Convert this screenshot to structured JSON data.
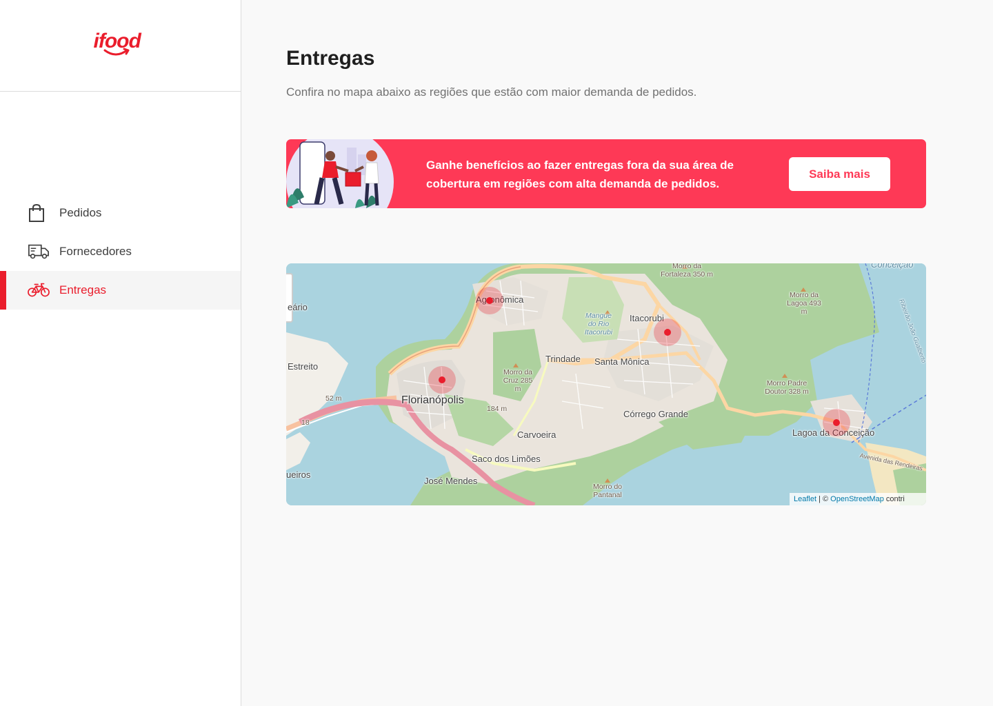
{
  "brand": {
    "logo_text": "ifood",
    "accent": "#ea1d2c",
    "banner_color": "#fe3956"
  },
  "sidebar": {
    "items": [
      {
        "label": "Pedidos",
        "icon": "shopping-bag-icon",
        "active": false
      },
      {
        "label": "Fornecedores",
        "icon": "truck-icon",
        "active": false
      },
      {
        "label": "Entregas",
        "icon": "bicycle-icon",
        "active": true
      }
    ]
  },
  "main": {
    "title": "Entregas",
    "subtitle": "Confira no mapa abaixo as regiões que estão com maior demanda de pedidos."
  },
  "banner": {
    "text": "Ganhe benefícios ao fazer entregas fora da sua área de cobertura em regiões com alta demanda de pedidos.",
    "button_label": "Saiba mais"
  },
  "map": {
    "labels": {
      "agronomica": "Agronômica",
      "itacorubi": "Itacorubi",
      "trindade": "Trindade",
      "santa_monica": "Santa Mônica",
      "estreito": "Estreito",
      "florianopolis": "Florianópolis",
      "corrego_grande": "Córrego Grande",
      "carvoeira": "Carvoeira",
      "saco_dos_limoes": "Saco dos Limões",
      "jose_mendes": "José Mendes",
      "lagoa_da_conceicao": "Lagoa da Conceição",
      "edge_left_top": "eário",
      "edge_left_bottom": "ueiros",
      "conceicao_edge": "Conceição",
      "avenida": "Avenida das Rendeiras",
      "ribeirao": "Ribeirão João Gualberto",
      "mangue": "Mangue do Rio Itacorubi",
      "morro_fortaleza": "Morro da Fortaleza 350 m",
      "morro_lagoa": "Morro da Lagoa 493 m",
      "morro_cruz": "Morro da Cruz 285 m",
      "morro_padre": "Morro Padre Doutor 328 m",
      "morro_pantanal": "Morro do Pantanal",
      "elev_184": "184 m",
      "elev_52": "52 m",
      "road_18": "18"
    },
    "attribution": {
      "leaflet": "Leaflet",
      "separator": " | © ",
      "osm": "OpenStreetMap",
      "suffix": " contri"
    },
    "hotspots": [
      "Agronômica",
      "Florianópolis",
      "Itacorubi",
      "Lagoa da Conceição"
    ]
  }
}
